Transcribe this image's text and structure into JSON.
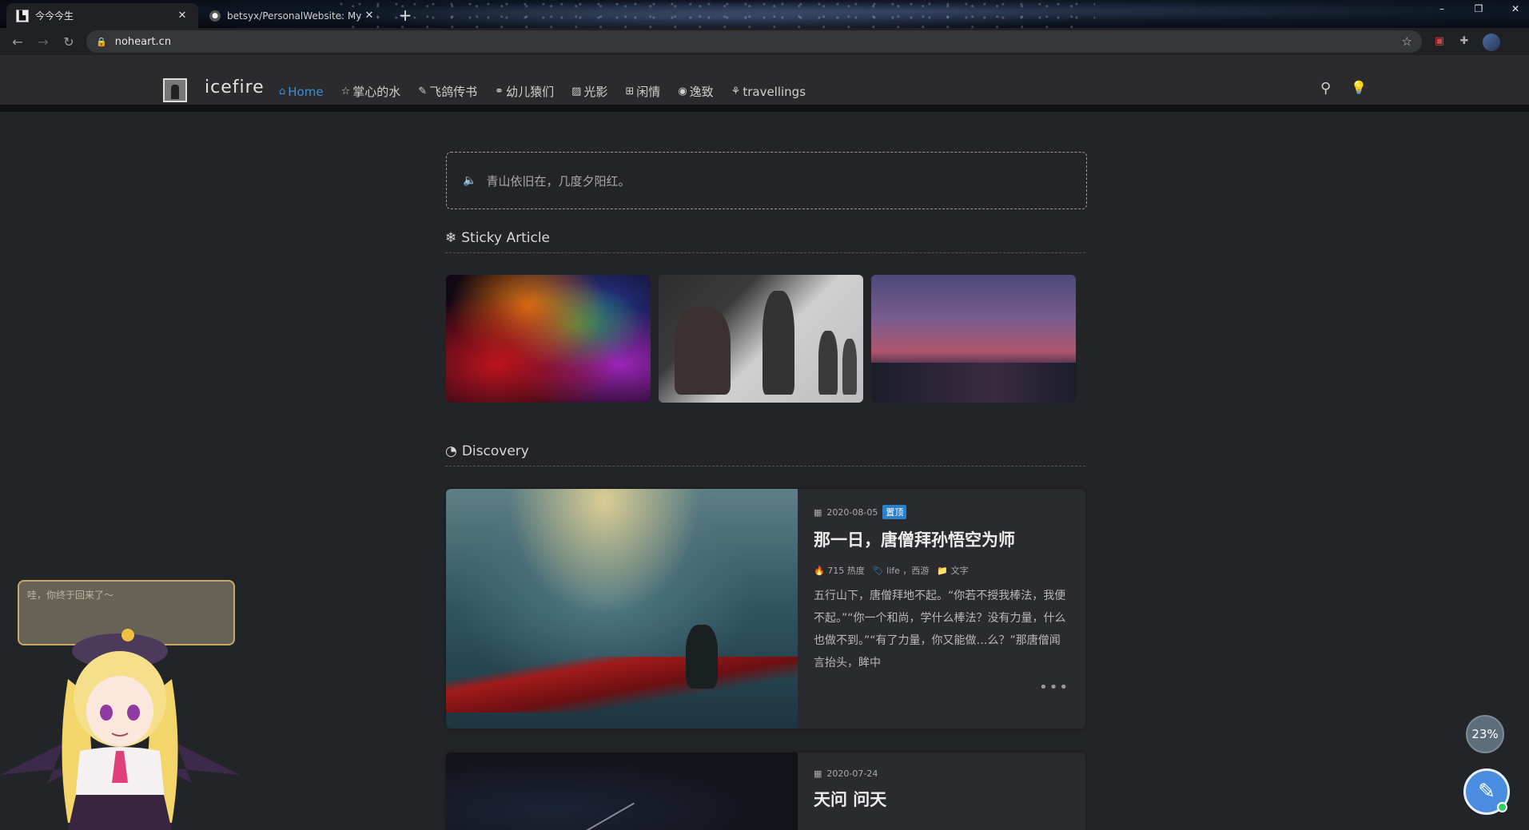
{
  "browser": {
    "tabs": [
      {
        "title": "今今今生",
        "active": true
      },
      {
        "title": "betsyx/PersonalWebsite: My pers",
        "active": false
      }
    ],
    "url": "noheart.cn",
    "window_controls": [
      "–",
      "❐",
      "✕"
    ]
  },
  "site": {
    "name": "icefire",
    "nav": [
      {
        "label": "Home",
        "icon": "home-icon"
      },
      {
        "label": "掌心的水",
        "icon": "star-icon"
      },
      {
        "label": "飞鸽传书",
        "icon": "edit-icon"
      },
      {
        "label": "幼儿猿们",
        "icon": "link-icon"
      },
      {
        "label": "光影",
        "icon": "image-icon"
      },
      {
        "label": "闲情",
        "icon": "plus-square-icon"
      },
      {
        "label": "逸致",
        "icon": "compass-icon"
      },
      {
        "label": "travellings",
        "icon": "train-icon"
      }
    ]
  },
  "notice": {
    "text": "青山依旧在，几度夕阳红。"
  },
  "sections": {
    "sticky": {
      "title": "Sticky Article",
      "icon": "snowflake-icon"
    },
    "discovery": {
      "title": "Discovery",
      "icon": "pie-chart-icon"
    }
  },
  "articles": [
    {
      "date": "2020-08-05",
      "badge": "置顶",
      "title": "那一日，唐僧拜孙悟空为师",
      "views": "715 热度",
      "tags": "life ，西游",
      "category": "文字",
      "excerpt": "五行山下，唐僧拜地不起。“你若不授我棒法，我便不起。”“你一个和尚，学什么棒法？没有力量，什么也做不到。”“有了力量，你又能做…么？”那唐僧闻言抬头，眸中",
      "more": "•••"
    },
    {
      "date": "2020-07-24",
      "title": "天问 问天"
    }
  ],
  "widget": {
    "tip": "哇，你终于回来了～",
    "progress": "23%"
  },
  "colors": {
    "accent": "#3b8fd6",
    "page_bg": "#232427",
    "header_bg": "#2b2b2e"
  }
}
